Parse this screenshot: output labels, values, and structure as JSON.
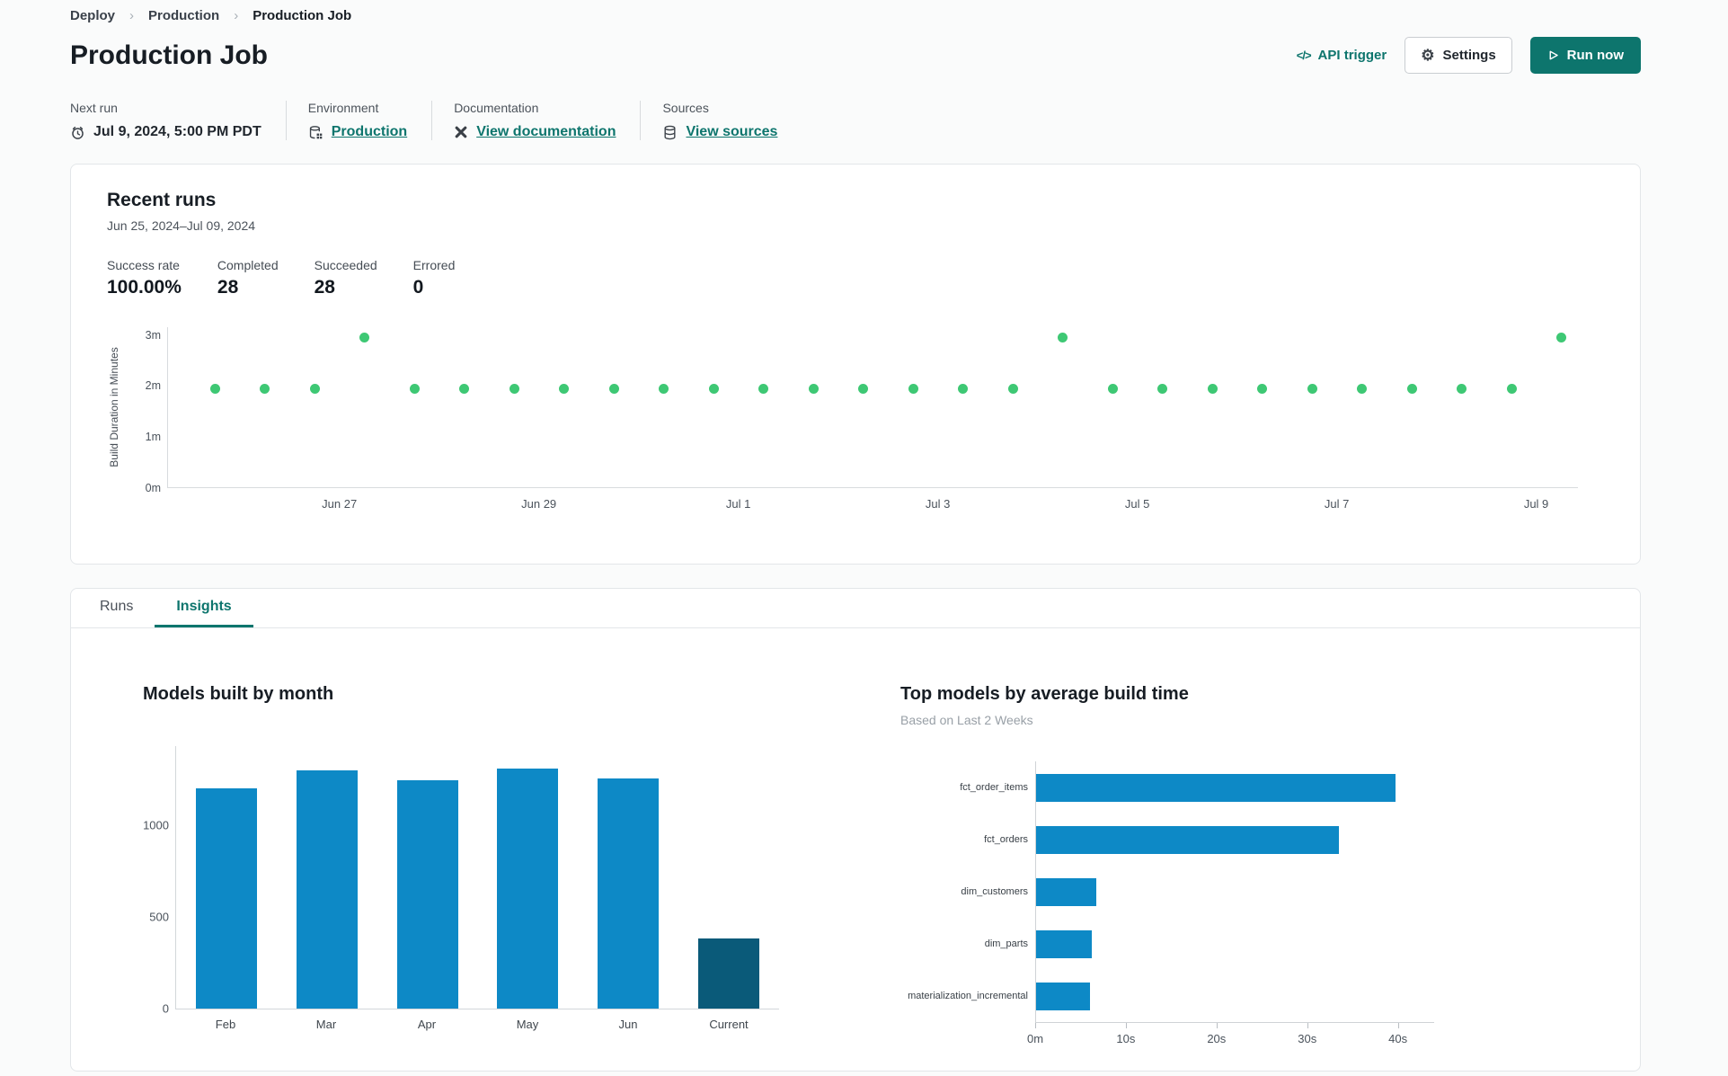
{
  "colors": {
    "accent": "#0d756d",
    "bar_blue": "#0d89c6",
    "bar_dark_blue": "#0a5a79",
    "dot_green": "#3ec874"
  },
  "breadcrumb": {
    "separator": "›",
    "items": [
      {
        "label": "Deploy"
      },
      {
        "label": "Production"
      },
      {
        "label": "Production Job"
      }
    ]
  },
  "header": {
    "title": "Production Job",
    "api_trigger_icon": "</>",
    "api_trigger_label": "API trigger",
    "settings_icon": "⚙",
    "settings_label": "Settings",
    "run_now_label": "Run now"
  },
  "meta": {
    "next_run": {
      "label": "Next run",
      "value": "Jul 9, 2024, 5:00 PM PDT"
    },
    "environment": {
      "label": "Environment",
      "link": "Production"
    },
    "documentation": {
      "label": "Documentation",
      "link": "View documentation"
    },
    "sources": {
      "label": "Sources",
      "link": "View sources"
    }
  },
  "recent_runs": {
    "title": "Recent runs",
    "date_range": "Jun 25, 2024–Jul 09, 2024",
    "stats": [
      {
        "label": "Success rate",
        "value": "100.00%"
      },
      {
        "label": "Completed",
        "value": "28"
      },
      {
        "label": "Succeeded",
        "value": "28"
      },
      {
        "label": "Errored",
        "value": "0"
      }
    ]
  },
  "tabs": [
    {
      "label": "Runs",
      "active": false
    },
    {
      "label": "Insights",
      "active": true
    }
  ],
  "chart_data": [
    {
      "name": "build-duration-scatter",
      "type": "scatter",
      "ylabel": "Build Duration in Minutes",
      "yticks": [
        "0m",
        "1m",
        "2m",
        "3m"
      ],
      "ylim": [
        0,
        3.15
      ],
      "xticks": [
        "Jun 27",
        "Jun 29",
        "Jul 1",
        "Jul 3",
        "Jul 5",
        "Jul 7",
        "Jul 9"
      ],
      "point_color": "#3ec874",
      "durations_minutes": [
        1.95,
        1.95,
        1.95,
        2.95,
        1.95,
        1.95,
        1.95,
        1.95,
        1.95,
        1.95,
        1.95,
        1.95,
        1.95,
        1.95,
        1.95,
        1.95,
        1.95,
        2.95,
        1.95,
        1.95,
        1.95,
        1.95,
        1.95,
        1.95,
        1.95,
        1.95,
        1.95,
        2.95
      ]
    },
    {
      "name": "models-built-by-month",
      "type": "bar",
      "title": "Models built by month",
      "categories": [
        "Feb",
        "Mar",
        "Apr",
        "May",
        "Jun",
        "Current"
      ],
      "values": [
        1200,
        1300,
        1245,
        1310,
        1255,
        380
      ],
      "yticks": [
        0,
        500,
        1000
      ],
      "ylim": [
        0,
        1430
      ],
      "bar_color": "#0d89c6",
      "highlight_color": "#0a5a79",
      "highlight_index": 5
    },
    {
      "name": "top-models-by-average-build-time",
      "type": "bar-horizontal",
      "title": "Top models by average build time",
      "subtitle": "Based on Last 2 Weeks",
      "categories": [
        "fct_order_items",
        "fct_orders",
        "dim_customers",
        "dim_parts",
        "materialization_incremental"
      ],
      "values_seconds": [
        39.7,
        33.5,
        6.7,
        6.2,
        6.0
      ],
      "xticks": [
        "0m",
        "10s",
        "20s",
        "30s",
        "40s"
      ],
      "xtick_values": [
        0,
        10,
        20,
        30,
        40
      ],
      "xlim": [
        0,
        44
      ],
      "bar_color": "#0d89c6"
    }
  ]
}
